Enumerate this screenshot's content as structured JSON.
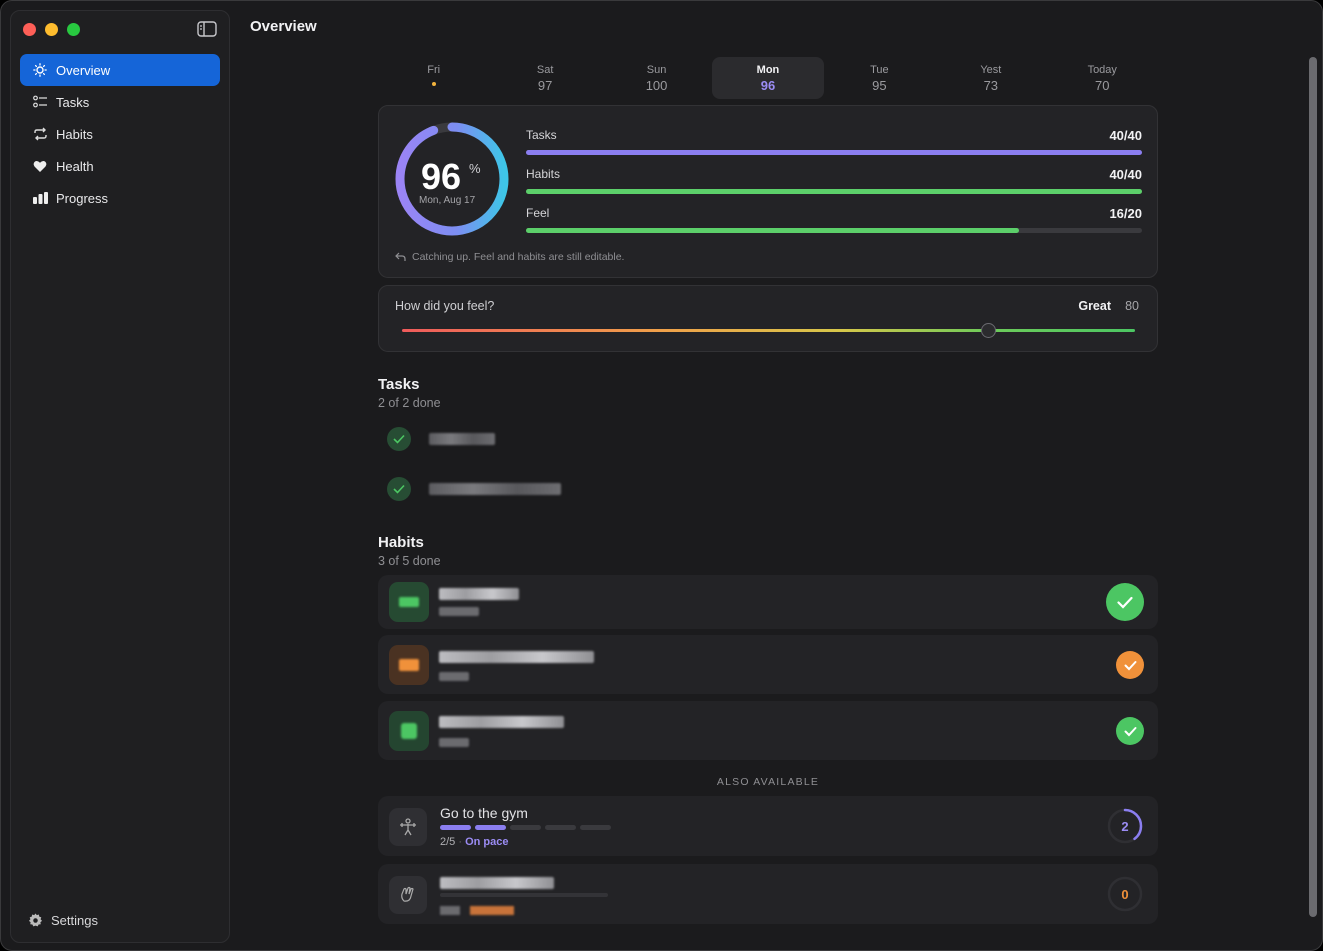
{
  "app": {
    "page_title": "Overview"
  },
  "sidebar": {
    "items": [
      {
        "label": "Overview",
        "icon": "sun-icon",
        "active": true
      },
      {
        "label": "Tasks",
        "icon": "checklist-icon",
        "active": false
      },
      {
        "label": "Habits",
        "icon": "repeat-icon",
        "active": false
      },
      {
        "label": "Health",
        "icon": "heart-icon",
        "active": false
      },
      {
        "label": "Progress",
        "icon": "bar-chart-icon",
        "active": false
      }
    ],
    "settings_label": "Settings"
  },
  "days": [
    {
      "name": "Fri",
      "value": "",
      "has_dot": true
    },
    {
      "name": "Sat",
      "value": "97"
    },
    {
      "name": "Sun",
      "value": "100"
    },
    {
      "name": "Mon",
      "value": "96",
      "selected": true
    },
    {
      "name": "Tue",
      "value": "95"
    },
    {
      "name": "Yest",
      "value": "73"
    },
    {
      "name": "Today",
      "value": "70"
    }
  ],
  "summary": {
    "score": "96",
    "score_unit": "%",
    "date": "Mon, Aug 17",
    "metrics": [
      {
        "label": "Tasks",
        "value": "40/40",
        "fraction": 1.0,
        "color": "#8b7ef0"
      },
      {
        "label": "Habits",
        "value": "40/40",
        "fraction": 1.0,
        "color": "#5ccf6a"
      },
      {
        "label": "Feel",
        "value": "16/20",
        "fraction": 0.8,
        "color": "#5ccf6a"
      }
    ],
    "note": "Catching up. Feel and habits are still editable."
  },
  "feel": {
    "question": "How did you feel?",
    "word": "Great",
    "value": "80",
    "fraction": 0.8
  },
  "tasks": {
    "title": "Tasks",
    "subtitle": "2 of 2 done"
  },
  "habits": {
    "title": "Habits",
    "subtitle": "3 of 5 done",
    "colors": {
      "green": "#4cc663",
      "orange": "#f0913a"
    }
  },
  "also_available": {
    "label": "ALSO AVAILABLE",
    "items": [
      {
        "name": "Go to the gym",
        "progress": "2/5",
        "pace": "On pace",
        "count": "2",
        "filled_segments": 2,
        "total_segments": 5,
        "ring_color": "#8b7ef0"
      },
      {
        "count": "0",
        "ring_color": "#f0913a"
      }
    ]
  },
  "accent": "#1565d8"
}
